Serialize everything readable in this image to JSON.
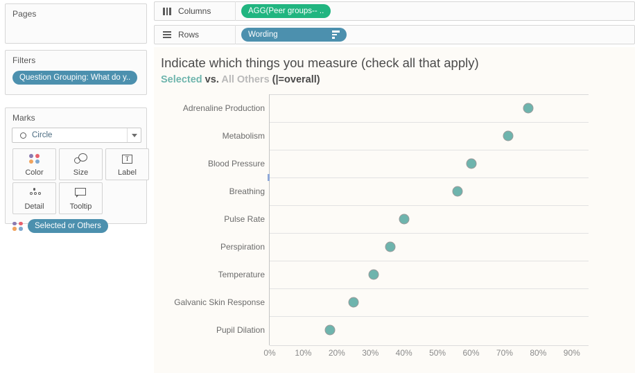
{
  "left_panel": {
    "pages": {
      "title": "Pages"
    },
    "filters": {
      "title": "Filters",
      "pill": "Question Grouping: What do y.."
    },
    "marks": {
      "title": "Marks",
      "mark_type": "Circle",
      "mark_type_icon": "circle-outline-icon",
      "buttons": [
        {
          "label": "Color",
          "icon": "color-dots-icon"
        },
        {
          "label": "Size",
          "icon": "size-circles-icon"
        },
        {
          "label": "Label",
          "icon": "label-text-icon"
        },
        {
          "label": "Detail",
          "icon": "detail-dots-icon"
        },
        {
          "label": "Tooltip",
          "icon": "tooltip-bubble-icon"
        }
      ],
      "color_pill": "Selected or Others"
    }
  },
  "shelves": {
    "columns": {
      "label": "Columns",
      "icon": "columns-bars-icon",
      "pill": "AGG(Peer groups-- ..",
      "pill_color": "#21b580"
    },
    "rows": {
      "label": "Rows",
      "icon": "rows-list-icon",
      "pill": "Wording",
      "pill_color": "#4c90ae",
      "sort_icon": "sort-descending-icon"
    }
  },
  "view": {
    "title": "Indicate  which things you measure (check all that apply)",
    "subtitle": {
      "selected": "Selected",
      "vs": " vs. ",
      "all_others": "All Others",
      "overall": " (|=overall)"
    }
  },
  "colors": {
    "mark": "#6eb4ad",
    "mark_border": "#9a9a9a",
    "selected_text": "#6fb5ad",
    "others_text": "#b9b9b9",
    "view_background": "#fdfbf7",
    "green_pill": "#21b580",
    "blue_pill": "#4c90ae",
    "color_dots": [
      "#8a7ab0",
      "#e8616d",
      "#f0a35e",
      "#7fa8d0"
    ]
  },
  "chart_data": {
    "type": "scatter",
    "title": "Indicate  which things you measure (check all that apply)",
    "subtitle": "Selected vs. All Others (|=overall)",
    "xlabel": "",
    "ylabel": "",
    "orientation": "horizontal",
    "xlim": [
      0,
      95
    ],
    "xtick_labels": [
      "0%",
      "10%",
      "20%",
      "30%",
      "40%",
      "50%",
      "60%",
      "70%",
      "80%",
      "90%"
    ],
    "xtick_values": [
      0,
      10,
      20,
      30,
      40,
      50,
      60,
      70,
      80,
      90
    ],
    "grid": "horizontal",
    "legend": null,
    "categories": [
      "Adrenaline Production",
      "Metabolism",
      "Blood Pressure",
      "Breathing",
      "Pulse Rate",
      "Perspiration",
      "Temperature",
      "Galvanic Skin Response",
      "Pupil Dilation"
    ],
    "series": [
      {
        "name": "Selected",
        "marker": "circle",
        "color": "#6eb4ad",
        "values": [
          77,
          71,
          60,
          56,
          40,
          36,
          31,
          25,
          18
        ]
      }
    ]
  }
}
